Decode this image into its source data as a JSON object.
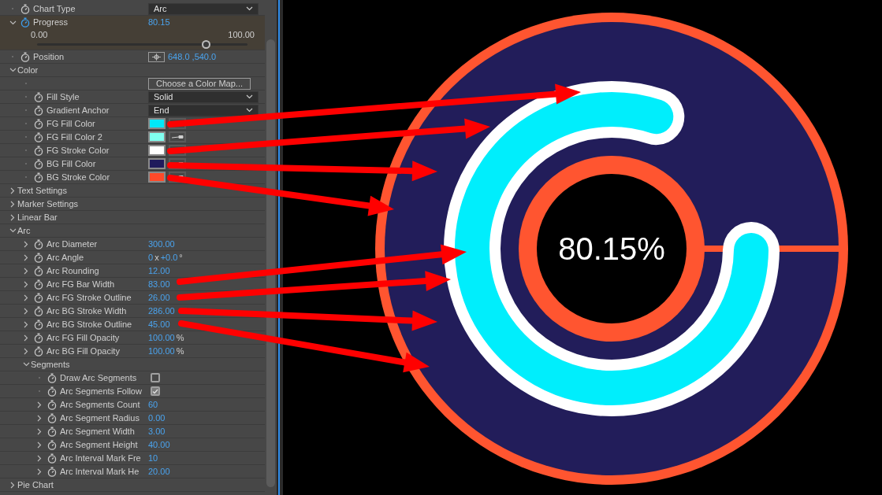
{
  "properties": [
    {
      "kind": "dropdown",
      "label": "Chart Type",
      "expandable": false,
      "value": "Arc"
    },
    {
      "kind": "slider",
      "label": "Progress",
      "expanded": true,
      "value": "80.15",
      "min": "0.00",
      "max": "100.00",
      "level": 0.8015
    },
    {
      "kind": "point",
      "label": "Position",
      "expandable": false,
      "value": "648.0 ,540.0"
    },
    {
      "kind": "group",
      "label": "Color",
      "expanded": true,
      "children": [
        {
          "kind": "button",
          "label": "Choose a Color Map..."
        },
        {
          "kind": "dropdown",
          "label": "Fill Style",
          "expandable": false,
          "value": "Solid"
        },
        {
          "kind": "dropdown",
          "label": "Gradient Anchor",
          "expandable": false,
          "value": "End"
        },
        {
          "kind": "color",
          "label": "FG Fill Color",
          "expandable": false,
          "color": "#00e8f8"
        },
        {
          "kind": "color",
          "label": "FG Fill Color 2",
          "expandable": false,
          "color": "#80fff0"
        },
        {
          "kind": "color",
          "label": "FG Stroke Color",
          "expandable": false,
          "color": "#ffffff"
        },
        {
          "kind": "color",
          "label": "BG Fill Color",
          "expandable": false,
          "color": "#1f1b5c"
        },
        {
          "kind": "color",
          "label": "BG Stroke Color",
          "expandable": false,
          "color": "#ff4a2a"
        }
      ]
    },
    {
      "kind": "group",
      "label": "Text Settings",
      "expanded": false
    },
    {
      "kind": "group",
      "label": "Marker Settings",
      "expanded": false
    },
    {
      "kind": "group",
      "label": "Linear Bar",
      "expanded": false
    },
    {
      "kind": "group",
      "label": "Arc",
      "expanded": true,
      "children": [
        {
          "kind": "number",
          "label": "Arc Diameter",
          "expandable": true,
          "value": "300.00"
        },
        {
          "kind": "angle",
          "label": "Arc Angle",
          "expandable": true,
          "revolutions": "0",
          "times": "x",
          "degrees": "+0.0",
          "unit": "°"
        },
        {
          "kind": "number",
          "label": "Arc Rounding",
          "expandable": true,
          "value": "12.00"
        },
        {
          "kind": "number",
          "label": "Arc FG Bar Width",
          "expandable": true,
          "value": "83.00"
        },
        {
          "kind": "number",
          "label": "Arc FG Stroke Outline",
          "expandable": true,
          "value": "26.00"
        },
        {
          "kind": "number",
          "label": "Arc BG Stroke Width",
          "expandable": true,
          "value": "286.00"
        },
        {
          "kind": "number",
          "label": "Arc BG Stroke Outline",
          "expandable": true,
          "value": "45.00"
        },
        {
          "kind": "number",
          "label": "Arc FG Fill Opacity",
          "expandable": true,
          "value": "100.00",
          "unit": "%"
        },
        {
          "kind": "number",
          "label": "Arc BG Fill Opacity",
          "expandable": true,
          "value": "100.00",
          "unit": "%"
        },
        {
          "kind": "group",
          "label": "Segments",
          "expanded": true,
          "children": [
            {
              "kind": "checkbox",
              "label": "Draw Arc Segments",
              "expandable": false,
              "checked": false
            },
            {
              "kind": "checkbox",
              "label": "Arc Segments Follow",
              "expandable": false,
              "checked": true
            },
            {
              "kind": "number",
              "label": "Arc Segments Count",
              "expandable": true,
              "value": "60"
            },
            {
              "kind": "number",
              "label": "Arc Segment Radius",
              "expandable": true,
              "value": "0.00"
            },
            {
              "kind": "number",
              "label": "Arc Segment Width",
              "expandable": true,
              "value": "3.00"
            },
            {
              "kind": "number",
              "label": "Arc Segment Height",
              "expandable": true,
              "value": "40.00"
            },
            {
              "kind": "number",
              "label": "Arc Interval Mark Fre",
              "expandable": true,
              "value": "10"
            },
            {
              "kind": "number",
              "label": "Arc Interval Mark He",
              "expandable": true,
              "value": "20.00"
            }
          ]
        }
      ]
    },
    {
      "kind": "group",
      "label": "Pie Chart",
      "expanded": false
    }
  ],
  "canvas": {
    "label": "80.15%"
  }
}
